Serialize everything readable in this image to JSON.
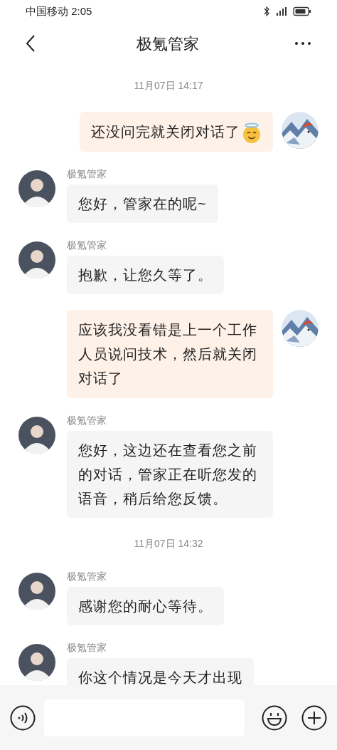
{
  "status_bar": {
    "carrier_time": "中国移动 2:05"
  },
  "header": {
    "title": "极氪管家"
  },
  "messages": [
    {
      "kind": "time",
      "text": "11月07日 14:17"
    },
    {
      "kind": "sent",
      "text": "还没问完就关闭对话了",
      "emoji": true
    },
    {
      "kind": "received",
      "sender": "极氪管家",
      "text": "您好，管家在的呢~"
    },
    {
      "kind": "received",
      "sender": "极氪管家",
      "text": "抱歉，让您久等了。"
    },
    {
      "kind": "sent",
      "text": "应该我没看错是上一个工作人员说问技术，然后就关闭对话了",
      "emoji": false
    },
    {
      "kind": "received",
      "sender": "极氪管家",
      "text": "您好，这边还在查看您之前的对话，管家正在听您发的语音，稍后给您反馈。"
    },
    {
      "kind": "time",
      "text": "11月07日 14:32"
    },
    {
      "kind": "received",
      "sender": "极氪管家",
      "text": "感谢您的耐心等待。"
    },
    {
      "kind": "received",
      "sender": "极氪管家",
      "text": "你这个情况是今天才出现"
    }
  ]
}
